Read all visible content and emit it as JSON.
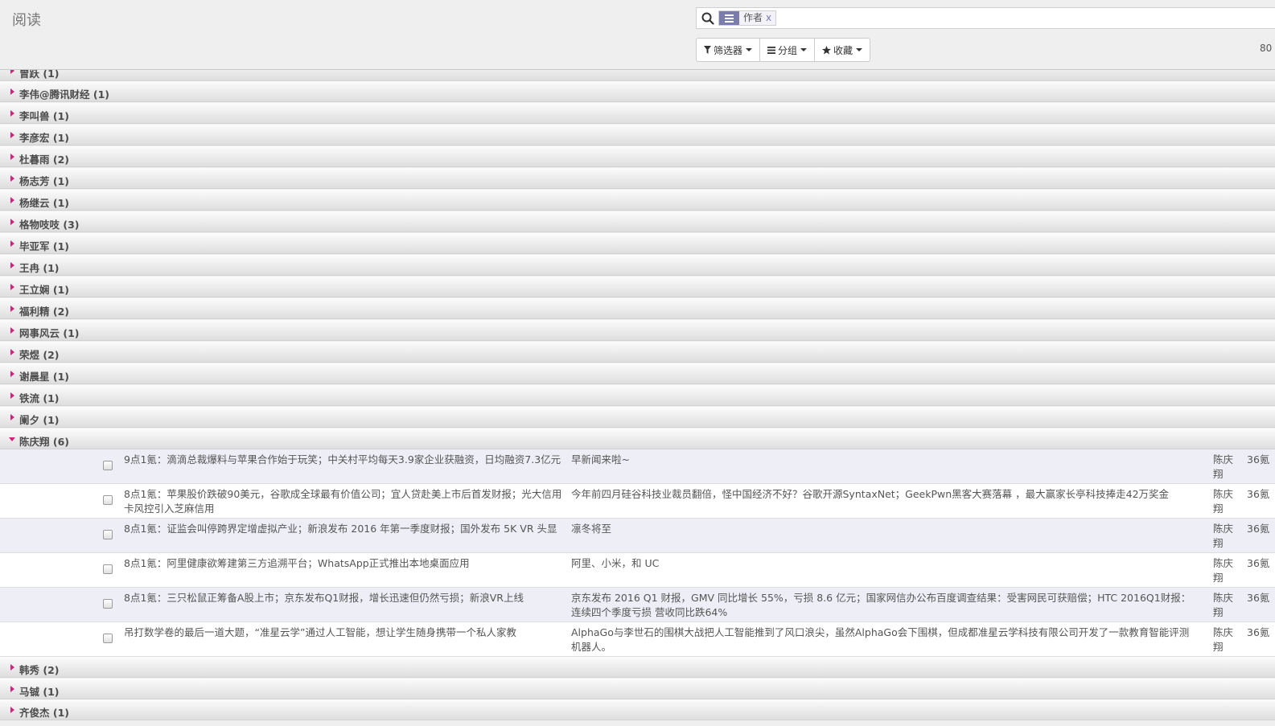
{
  "app": {
    "title": "阅读"
  },
  "search": {
    "facet_value": "作者",
    "facet_remove": "x"
  },
  "toolbar": {
    "filters_label": "筛选器",
    "groupby_label": "分组",
    "favorites_label": "收藏"
  },
  "pager": {
    "text": "80"
  },
  "groups_top": [
    {
      "label": "曾跃 (1)",
      "expanded": false
    },
    {
      "label": "李伟@腾讯财经 (1)",
      "expanded": false
    },
    {
      "label": "李叫兽 (1)",
      "expanded": false
    },
    {
      "label": "李彦宏 (1)",
      "expanded": false
    },
    {
      "label": "杜暮雨 (2)",
      "expanded": false
    },
    {
      "label": "杨志芳 (1)",
      "expanded": false
    },
    {
      "label": "杨继云 (1)",
      "expanded": false
    },
    {
      "label": "格物吱吱 (3)",
      "expanded": false
    },
    {
      "label": "毕亚军 (1)",
      "expanded": false
    },
    {
      "label": "王冉 (1)",
      "expanded": false
    },
    {
      "label": "王立娴 (1)",
      "expanded": false
    },
    {
      "label": "福利精 (2)",
      "expanded": false
    },
    {
      "label": "网事风云 (1)",
      "expanded": false
    },
    {
      "label": "荣煜 (2)",
      "expanded": false
    },
    {
      "label": "谢晨星 (1)",
      "expanded": false
    },
    {
      "label": "铁流 (1)",
      "expanded": false
    },
    {
      "label": "阑夕 (1)",
      "expanded": false
    },
    {
      "label": "陈庆翔 (6)",
      "expanded": true
    }
  ],
  "records": [
    {
      "title": "9点1氪：滴滴总裁爆料与苹果合作始于玩笑；中关村平均每天3.9家企业获融资，日均融资7.3亿元",
      "desc": "早新闻来啦~",
      "author": "陈庆翔",
      "source": "36氪"
    },
    {
      "title": "8点1氪：苹果股价跌破90美元，谷歌成全球最有价值公司；宜人贷赴美上市后首发财报；光大信用卡风控引入芝麻信用",
      "desc": "今年前四月硅谷科技业裁员翻倍，怪中国经济不好？谷歌开源SyntaxNet；GeekPwn黑客大赛落幕 ，最大赢家长亭科技捧走42万奖金",
      "author": "陈庆翔",
      "source": "36氪"
    },
    {
      "title": "8点1氪：证监会叫停跨界定增虚拟产业；新浪发布 2016 年第一季度财报；国外发布 5K VR 头显",
      "desc": "凛冬将至",
      "author": "陈庆翔",
      "source": "36氪"
    },
    {
      "title": "8点1氪：阿里健康欲筹建第三方追溯平台；WhatsApp正式推出本地桌面应用",
      "desc": "阿里、小米，和 UC",
      "author": "陈庆翔",
      "source": "36氪"
    },
    {
      "title": "8点1氪：三只松鼠正筹备A股上市；京东发布Q1财报，增长迅速但仍然亏损；新浪VR上线",
      "desc": "京东发布 2016 Q1 财报，GMV 同比增长 55%，亏损 8.6 亿元；国家网信办公布百度调查结果：受害网民可获赔偿；HTC 2016Q1财报：连续四个季度亏损 营收同比跌64%",
      "author": "陈庆翔",
      "source": "36氪"
    },
    {
      "title": "吊打数学卷的最后一道大题，“准星云学”通过人工智能，想让学生随身携带一个私人家教",
      "desc": "AlphaGo与李世石的围棋大战把人工智能推到了风口浪尖，虽然AlphaGo会下围棋，但成都准星云学科技有限公司开发了一款教育智能评测机器人。",
      "author": "陈庆翔",
      "source": "36氪"
    }
  ],
  "groups_bottom": [
    {
      "label": "韩秀 (2)",
      "expanded": false
    },
    {
      "label": "马铖 (1)",
      "expanded": false
    },
    {
      "label": "齐俊杰 (1)",
      "expanded": false
    }
  ]
}
